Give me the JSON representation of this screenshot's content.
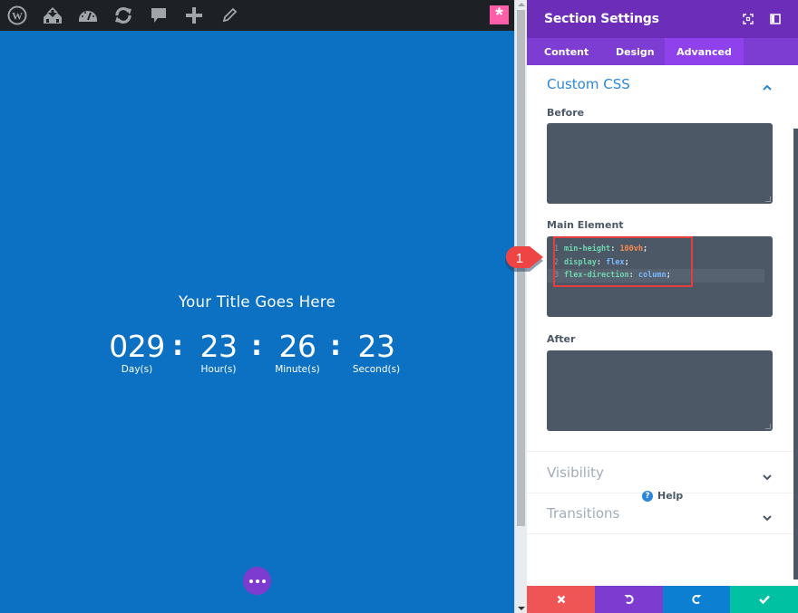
{
  "admin_bar": {
    "icons": [
      "wordpress-icon",
      "my-sites-icon",
      "dashboard-icon",
      "updates-icon",
      "comments-icon",
      "new-content-icon",
      "edit-icon"
    ],
    "builder_toggle": "*"
  },
  "canvas": {
    "title": "Your Title Goes Here",
    "countdown": [
      {
        "value": "029",
        "label": "Day(s)"
      },
      {
        "value": "23",
        "label": "Hour(s)"
      },
      {
        "value": "26",
        "label": "Minute(s)"
      },
      {
        "value": "23",
        "label": "Second(s)"
      }
    ],
    "separator": ":",
    "background_color": "#0c71c3"
  },
  "panel": {
    "title": "Section Settings",
    "tabs": [
      {
        "label": "Content",
        "active": false
      },
      {
        "label": "Design",
        "active": false
      },
      {
        "label": "Advanced",
        "active": true
      }
    ],
    "custom_css": {
      "title": "Custom CSS",
      "before_label": "Before",
      "main_label": "Main Element",
      "after_label": "After",
      "main_code": [
        {
          "num": "1",
          "prop": "min-height",
          "value": "100vh",
          "value_type": "number"
        },
        {
          "num": "2",
          "prop": "display",
          "value": "flex",
          "value_type": "keyword"
        },
        {
          "num": "3",
          "prop": "flex-direction",
          "value": "column",
          "value_type": "keyword"
        }
      ]
    },
    "collapsed_sections": [
      "Visibility",
      "Transitions"
    ],
    "help_label": "Help",
    "footer": {
      "cancel": "cancel-icon",
      "undo": "undo-icon",
      "redo": "redo-icon",
      "save": "save-icon"
    },
    "accent_color": "#6c2eb9",
    "tab_active_color": "#8f42ec"
  },
  "callout": {
    "number": "1",
    "color": "#ef4444"
  }
}
